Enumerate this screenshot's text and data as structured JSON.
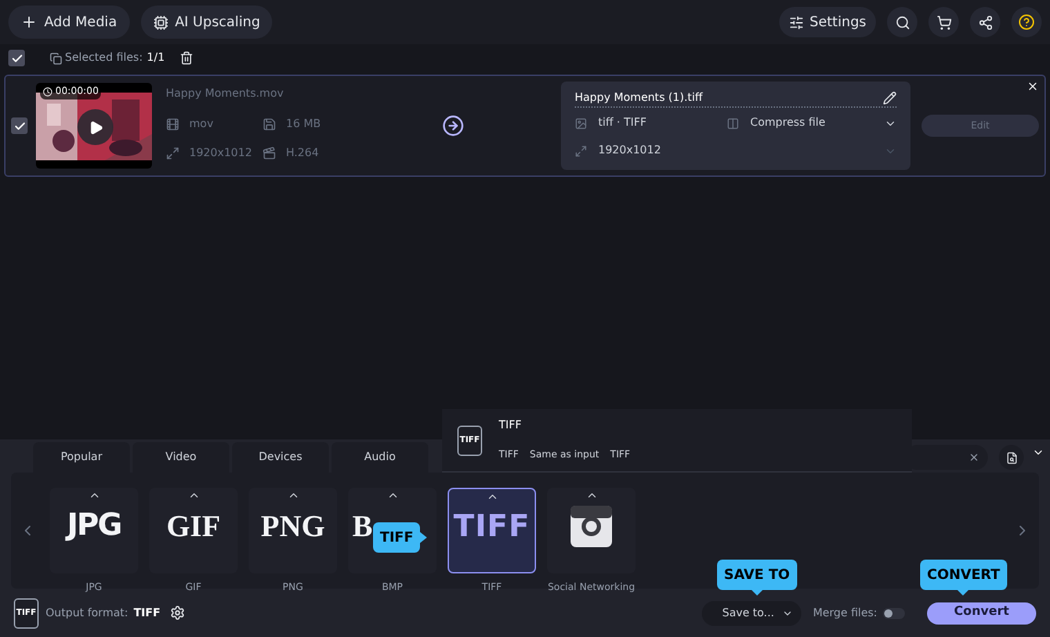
{
  "toolbar": {
    "buttons": [
      {
        "label": "Add Media",
        "kind": "add"
      },
      {
        "label": "AI Upscaling",
        "kind": "ai"
      }
    ],
    "settings": "Settings"
  },
  "selection": {
    "checked": true,
    "label": "Selected files:",
    "count": "1/1"
  },
  "file": {
    "checked": true,
    "duration": "00:00:00",
    "name": "Happy Moments.mov",
    "format": "mov",
    "size": "16 MB",
    "resolution": "1920x1012",
    "codec": "H.264",
    "output": {
      "name": "Happy Moments (1).tiff",
      "format": "tiff · TIFF",
      "resolution": "1920x1012",
      "compress": "Compress file"
    },
    "edit": {
      "label": "Edit",
      "disabled": true
    }
  },
  "tabs": [
    {
      "label": "Popular",
      "selected": false
    },
    {
      "label": "Video",
      "selected": false
    },
    {
      "label": "Devices",
      "selected": false
    },
    {
      "label": "Audio",
      "selected": false
    }
  ],
  "popup": {
    "icon": "TIFF",
    "title": "TIFF",
    "details": [
      "TIFF",
      "Same as input",
      "TIFF"
    ]
  },
  "formats": [
    {
      "label": "JPG",
      "logo": "JPG",
      "kind": "jpg",
      "selected": false
    },
    {
      "label": "GIF",
      "logo": "GIF",
      "kind": "gif",
      "selected": false
    },
    {
      "label": "PNG",
      "logo": "PNG",
      "kind": "png",
      "selected": false
    },
    {
      "label": "BMP",
      "logo": "B",
      "kind": "bmp",
      "selected": false
    },
    {
      "label": "TIFF",
      "logo": "TIFF",
      "kind": "tiff",
      "selected": true
    },
    {
      "label": "Social Networking",
      "kind": "camera",
      "selected": false
    }
  ],
  "output_format": {
    "icon": "TIFF",
    "label": "Output format:",
    "value": "TIFF"
  },
  "save_to": "Save to...",
  "merge": {
    "label": "Merge files:",
    "on": false
  },
  "convert": "Convert",
  "callouts": [
    {
      "text": "TIFF",
      "kind": "right"
    },
    {
      "text": "SAVE TO",
      "kind": "down"
    },
    {
      "text": "CONVERT",
      "kind": "down"
    }
  ]
}
